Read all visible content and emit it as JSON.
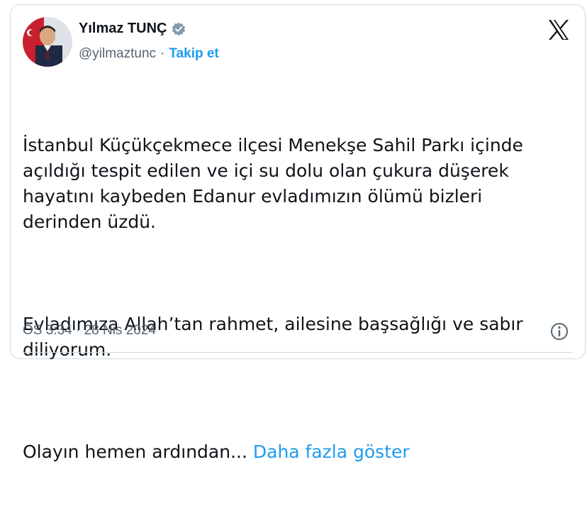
{
  "author": {
    "name": "Yılmaz TUNÇ",
    "handle": "@yilmaztunc",
    "separator": "·",
    "follow_label": "Takip et"
  },
  "tweet": {
    "paragraphs": [
      "İstanbul Küçükçekmece ilçesi Menekşe Sahil Parkı içinde\naçıldığı tespit edilen ve içi su dolu olan çukura düşerek\nhayatını kaybeden Edanur evladımızın ölümü bizleri\nderinden üzdü.",
      "Evladımıza Allah’tan rahmet, ailesine başsağlığı ve sabır\ndiliyorum."
    ],
    "truncated_text": "Olayın hemen ardından... ",
    "show_more_label": "Daha fazla göster",
    "timestamp": "ÖS 3:34 · 28 Nis 2024"
  },
  "icons": {
    "verified": "verified-badge-icon",
    "platform": "x-logo-icon",
    "info": "info-icon"
  },
  "colors": {
    "link": "#1d9bf0",
    "secondary_text": "#536471",
    "border": "#cfd9de"
  }
}
